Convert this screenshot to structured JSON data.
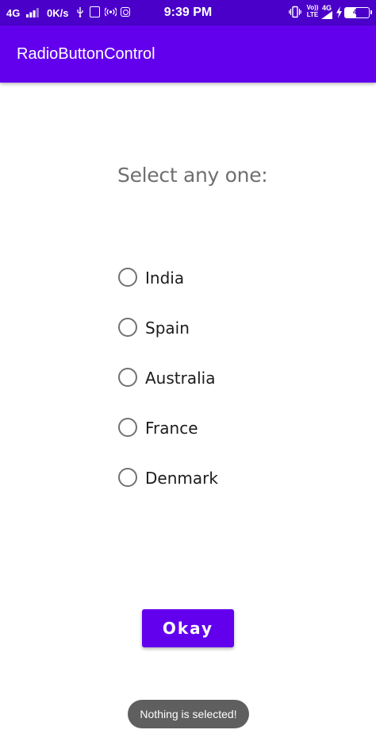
{
  "status_bar": {
    "network_type": "4G",
    "network_speed": "0K/s",
    "time": "9:39 PM",
    "volte_label": "Vo)) LTE",
    "network_type_2": "4G",
    "battery_level": "47",
    "battery_fraction": 0.47,
    "icons": [
      "signal-icon",
      "usb-icon",
      "app-badge-icon",
      "hotspot-icon",
      "instagram-icon",
      "vibrate-icon",
      "signal-icon",
      "charging-icon",
      "battery-icon"
    ]
  },
  "app_bar": {
    "title": "RadioButtonControl"
  },
  "main": {
    "prompt": "Select any one:",
    "options": [
      {
        "label": "India",
        "checked": false
      },
      {
        "label": "Spain",
        "checked": false
      },
      {
        "label": "Australia",
        "checked": false
      },
      {
        "label": "France",
        "checked": false
      },
      {
        "label": "Denmark",
        "checked": false
      }
    ],
    "okay_label": "Okay"
  },
  "toast": {
    "message": "Nothing is selected!"
  },
  "colors": {
    "status_bar": "#4a00c9",
    "primary": "#6200ee",
    "radio_border": "#717171",
    "toast_bg": "#5f5f5f"
  }
}
